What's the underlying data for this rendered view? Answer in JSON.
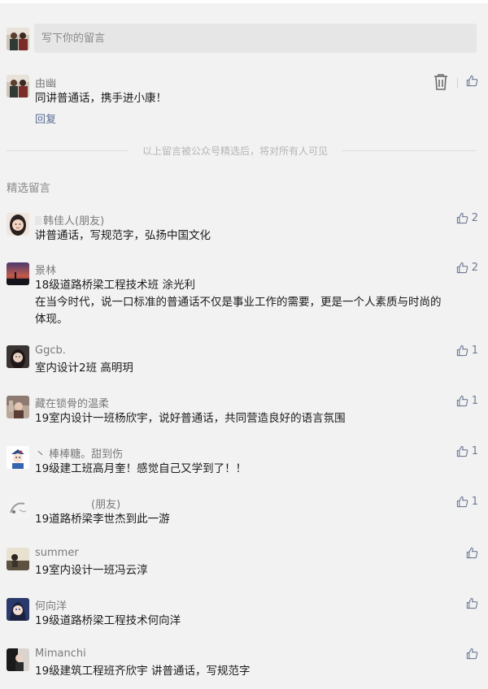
{
  "compose": {
    "placeholder": "写下你的留言"
  },
  "my_comment": {
    "name": "由幽",
    "text": "同讲普通话，携手进小康！",
    "reply_label": "回复"
  },
  "notice": "以上留言被公众号精选后，将对所有人可见",
  "section_title": "精选留言",
  "comments": [
    {
      "name": "韩佳人(朋友)",
      "lines": [
        "讲普通话，写规范字，弘扬中国文化"
      ],
      "likes": "2"
    },
    {
      "name": "景林",
      "lines": [
        "18级道路桥梁工程技术班  涂光利",
        "在当今时代，说一口标准的普通话不仅是事业工作的需要，更是一个人素质与时尚的",
        "体现。"
      ],
      "likes": "2"
    },
    {
      "name": "Ggcb.",
      "lines": [
        "室内设计2班 高明玥"
      ],
      "likes": "1"
    },
    {
      "name": "藏在锁骨的温柔",
      "lines": [
        "19室内设计一班杨欣宇，说好普通话，共同营造良好的语言氛围"
      ],
      "likes": "1"
    },
    {
      "name": "丶 棒棒糖。甜到伤",
      "lines": [
        "19级建工班高月奎！感觉自己又学到了！！"
      ],
      "likes": "1"
    },
    {
      "name": "(朋友)",
      "lines": [
        "19道路桥梁李世杰到此一游"
      ],
      "likes": "1"
    },
    {
      "name": "summer",
      "lines": [
        "19室内设计一班冯云淳"
      ],
      "likes": ""
    },
    {
      "name": "何向洋",
      "lines": [
        "19级道路桥梁工程技术何向洋"
      ],
      "likes": ""
    },
    {
      "name": "Mimanchi",
      "lines": [
        "19级建筑工程班齐欣宇  讲普通话，写规范字"
      ],
      "likes": ""
    }
  ],
  "colors": {
    "link": "#576b95",
    "background": "#f2f2f2",
    "input_bg": "#e6e6e6"
  }
}
